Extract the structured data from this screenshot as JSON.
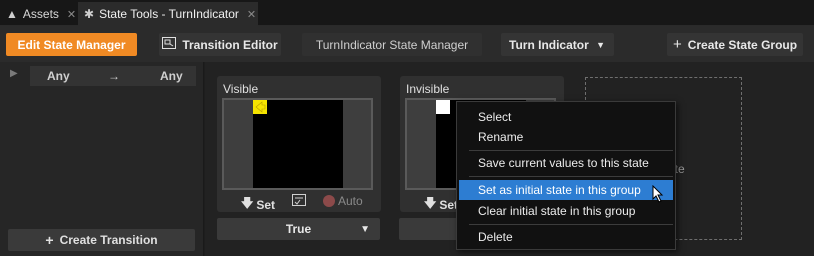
{
  "tabs": [
    {
      "label": "Assets",
      "icon": "asset-icon"
    },
    {
      "label": "State Tools - TurnIndicator",
      "icon": "state-tools-icon"
    }
  ],
  "toolbar": {
    "edit_state_manager": "Edit State Manager",
    "transition_editor": "Transition Editor",
    "manager_name": "TurnIndicator State Manager",
    "group_select": "Turn Indicator",
    "create_state_group": "Create State Group"
  },
  "transitions": {
    "from": "Any",
    "to": "Any",
    "arrow": "→",
    "create_transition": "Create Transition"
  },
  "states": [
    {
      "name": "Visible",
      "swatch_color": "#f5e400"
    },
    {
      "name": "Invisible",
      "swatch_color": "#ffffff"
    }
  ],
  "state_actions": {
    "set": "Set",
    "auto": "Auto"
  },
  "group_value": "True",
  "drop_hint": "ate",
  "context_menu": {
    "items": [
      "Select",
      "Rename",
      "Save current values to this state",
      "Set as initial state in this group",
      "Clear initial state in this group",
      "Delete"
    ],
    "highlighted_index": 3
  },
  "colors": {
    "accent": "#f08a24",
    "menu_highlight": "#2d7dd2"
  }
}
